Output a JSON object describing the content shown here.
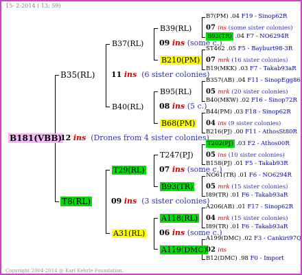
{
  "header": "15- 2-2014 ( 13: 59)",
  "footer": "Copyright 2004-2014 @ Karl Kehrle Foundation.",
  "root": {
    "name": "B181(VBB)",
    "num": "12",
    "ins": "ins",
    "cols": "(Drones from 4 sister colonies)"
  },
  "sire": {
    "name": "B35(RL)",
    "num": "11",
    "ins": "ins",
    "cols": "(6 sister colonies)"
  },
  "dam": {
    "name": "T8(RL)",
    "num": "09",
    "ins": "ins",
    "cols": "(3 sister colonies)"
  },
  "g2": [
    {
      "name": "B37(RL)"
    },
    {
      "name": "B40(RL)"
    },
    {
      "name": "T29(RL)"
    },
    {
      "name": "A31(RL)"
    }
  ],
  "g3": [
    {
      "name": "B39(RL)",
      "num": "09",
      "ins": "ins",
      "cols": "(some c.)"
    },
    {
      "name": "B210(PM)",
      "num": "",
      "ins": "",
      "cols": ""
    },
    {
      "name": "B95(RL)",
      "num": "",
      "ins": "",
      "cols": ""
    },
    {
      "name": "B68(PM)",
      "num": "08",
      "ins": "ins",
      "cols": "(5 c.)"
    },
    {
      "name": "T247(PJ)",
      "num": "",
      "ins": "",
      "cols": ""
    },
    {
      "name": "B93(TR)",
      "num": "07",
      "ins": "ins",
      "cols": "(some c.)"
    },
    {
      "name": "A118(RL)",
      "num": "",
      "ins": "",
      "cols": ""
    },
    {
      "name": "A119(DMC)",
      "num": "06",
      "ins": "ins",
      "cols": "(some c.)"
    }
  ],
  "g4": [
    {
      "name": "B7(PM)",
      "val": ".04",
      "info": "F19 - Sinop62R"
    },
    {
      "num": "07",
      "ins": "ins",
      "cols": "(some sister colonies)"
    },
    {
      "name": "B93(TR)",
      "val": ".04",
      "info": "F7 - NO6294R"
    },
    {
      "name": "ST462",
      "val": ".05",
      "info": "F5 - Bayburt98-3R"
    },
    {
      "num": "07",
      "ins": "mrk",
      "cols": "(16 sister colonies)"
    },
    {
      "name": "B19(MKK)",
      "val": ".03",
      "info": "F7 - Takab93aR"
    },
    {
      "name": "B357(AB)",
      "val": ".04",
      "info": "F11 - SinopEgg86R"
    },
    {
      "num": "05",
      "ins": "mrk",
      "cols": "(20 sister colonies)"
    },
    {
      "name": "B40(MKW)",
      "val": ".02",
      "info": "F16 - Sinop72R"
    },
    {
      "name": "B44(PM)",
      "val": ".03",
      "info": "F18 - Sinop62R"
    },
    {
      "num": "04",
      "ins": "ins",
      "cols": "(9 sister colonies)"
    },
    {
      "name": "B216(PJ)",
      "val": ".00",
      "info": "F11 - AthosSt80R"
    },
    {
      "name": "T202(PJ)",
      "val": ".03",
      "info": "F2 - Athos00R"
    },
    {
      "num": "05",
      "ins": "ins",
      "cols": "(10 sister colonies)"
    },
    {
      "name": "B158(PJ)",
      "val": ".01",
      "info": "F5 - Takab93R"
    },
    {
      "name": "NO61(TR)",
      "val": ".01",
      "info": "F6 - NO6294R"
    },
    {
      "num": "05",
      "ins": "mrk",
      "cols": "(15 sister colonies)"
    },
    {
      "name": "I89(TR)",
      "val": ".01",
      "info": "F6 - Takab93aR"
    },
    {
      "name": "A206(AB)",
      "val": ".01",
      "info": "F17 - Sinop62R"
    },
    {
      "num": "04",
      "ins": "mrk",
      "cols": "(15 sister colonies)"
    },
    {
      "name": "I89(TR)",
      "val": ".01",
      "info": "F6 - Takab93aR"
    },
    {
      "name": "A199(DMC)",
      "val": ".02",
      "info": "F3 - Cankiri97Q"
    },
    {
      "num": "02",
      "ins": "ins",
      "cols": ""
    },
    {
      "name": "B12(DMC)",
      "val": ".98",
      "info": "F0 - Import"
    }
  ],
  "colors": {
    "border": "#d040c0",
    "green": "#00dd00",
    "yellow": "#ffff00",
    "pink": "#f4b8f4",
    "red": "#d00000",
    "blue": "#0000a0"
  }
}
